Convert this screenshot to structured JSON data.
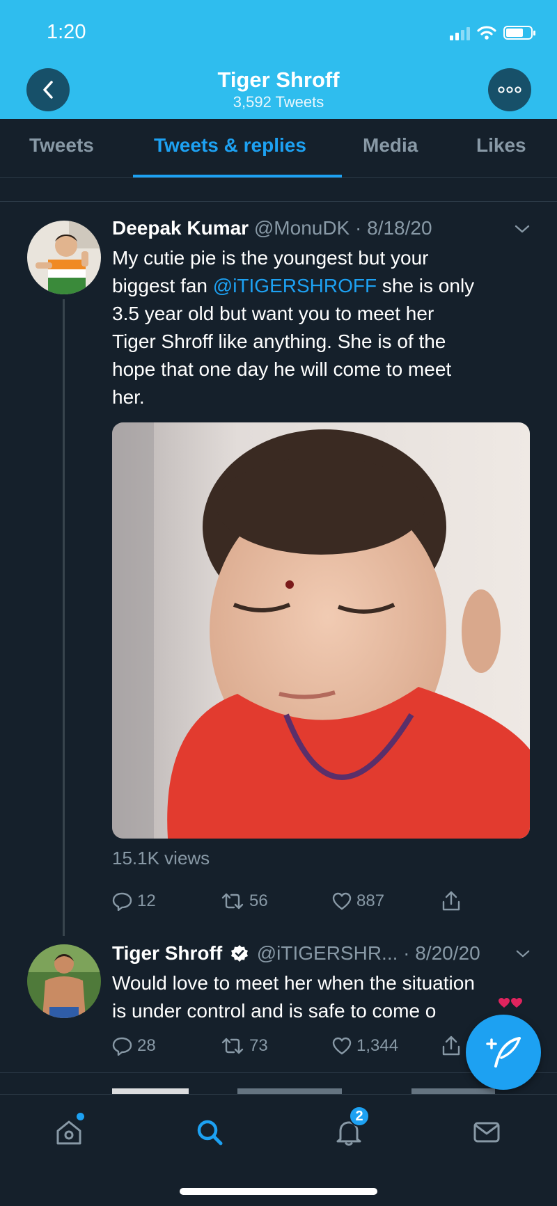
{
  "status_bar": {
    "time": "1:20"
  },
  "nav": {
    "title": "Tiger Shroff",
    "subtitle": "3,592 Tweets"
  },
  "tabs": [
    {
      "label": "Tweets"
    },
    {
      "label": "Tweets & replies"
    },
    {
      "label": "Media"
    },
    {
      "label": "Likes"
    }
  ],
  "tweets": [
    {
      "name": "Deepak Kumar",
      "meta": "@MonuDK · 8/18/20",
      "text_lines": [
        "My cutie pie is the youngest but your",
        "biggest fan ",
        " she is only",
        "3.5 year old but want you to meet her",
        "Tiger Shroff like anything. She is of the",
        "hope that one day he will come to meet",
        "her."
      ],
      "mention": "@iTIGERSHROFF",
      "views": "15.1K views",
      "replies": "12",
      "retweets": "56",
      "likes": "887"
    },
    {
      "name": "Tiger Shroff",
      "meta": "@iTIGERSHR... · 8/20/20",
      "text_lines": [
        "Would love to meet her when the situation",
        "is under control and is safe to come o"
      ],
      "replies": "28",
      "retweets": "73",
      "likes": "1,344"
    }
  ],
  "bottom_bar": {
    "notifications_badge": "2"
  },
  "colors": {
    "header_bg": "#2fbdee",
    "accent": "#1da1f2",
    "page_bg": "#15202b"
  }
}
